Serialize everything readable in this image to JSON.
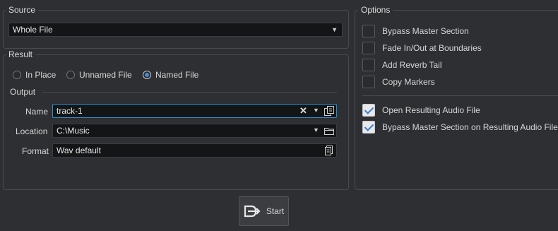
{
  "source": {
    "title": "Source",
    "selected": "Whole File"
  },
  "result": {
    "title": "Result",
    "modes": [
      "In Place",
      "Unnamed File",
      "Named File"
    ],
    "selected_mode": "Named File"
  },
  "output": {
    "title": "Output",
    "name_label": "Name",
    "name_value": "track-1",
    "location_label": "Location",
    "location_value": "C:\\Music",
    "format_label": "Format",
    "format_value": "Wav default"
  },
  "options": {
    "title": "Options",
    "items": [
      {
        "label": "Bypass Master Section",
        "checked": false
      },
      {
        "label": "Fade In/Out at Boundaries",
        "checked": false
      },
      {
        "label": "Add Reverb Tail",
        "checked": false
      },
      {
        "label": "Copy Markers",
        "checked": false
      },
      {
        "label": "Open Resulting Audio File",
        "checked": true
      },
      {
        "label": "Bypass Master Section on Resulting Audio File",
        "checked": true
      }
    ]
  },
  "start": {
    "label": "Start"
  },
  "colors": {
    "accent": "#2f8ecf",
    "panel": "#2e2f32",
    "field": "#141516"
  }
}
